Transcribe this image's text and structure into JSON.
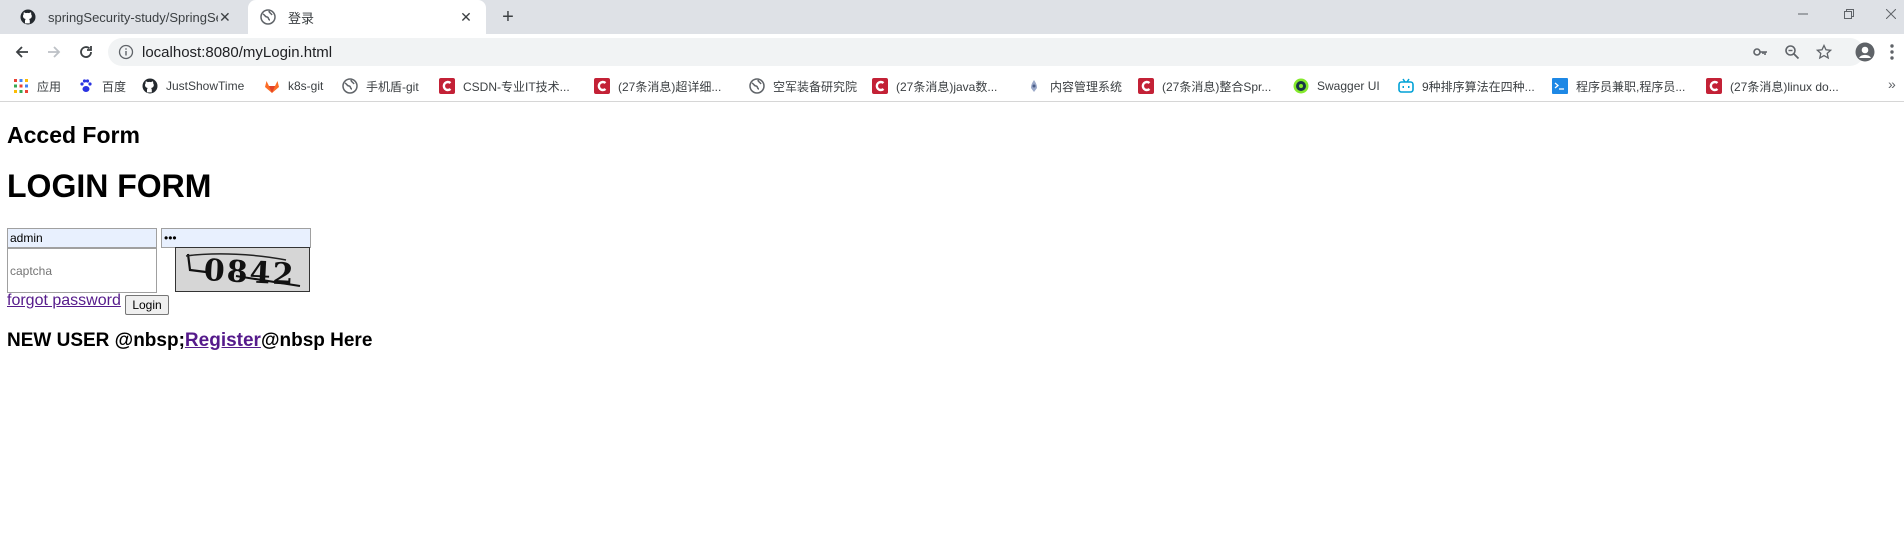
{
  "browser": {
    "tabs": [
      {
        "title": "springSecurity-study/SpringSecu",
        "icon": "github-icon",
        "active": false
      },
      {
        "title": "登录",
        "icon": "globe-icon",
        "active": true
      }
    ],
    "new_tab_symbol": "+",
    "tab_close_symbol": "✕",
    "address_url": "localhost:8080/myLogin.html",
    "bookmarks": [
      {
        "label": "应用",
        "icon": "apps-grid-icon"
      },
      {
        "label": "百度",
        "icon": "baidu-paw-icon"
      },
      {
        "label": "JustShowTime",
        "icon": "github-icon"
      },
      {
        "label": "k8s-git",
        "icon": "gitlab-icon"
      },
      {
        "label": "手机盾-git",
        "icon": "globe-icon"
      },
      {
        "label": "CSDN-专业IT技术...",
        "icon": "csdn-icon"
      },
      {
        "label": "(27条消息)超详细...",
        "icon": "csdn-icon"
      },
      {
        "label": "空军装备研究院",
        "icon": "globe-icon"
      },
      {
        "label": "(27条消息)java数...",
        "icon": "csdn-icon"
      },
      {
        "label": "内容管理系统",
        "icon": "cms-icon"
      },
      {
        "label": "(27条消息)整合Spr...",
        "icon": "csdn-icon"
      },
      {
        "label": "Swagger UI",
        "icon": "swagger-icon"
      },
      {
        "label": "9种排序算法在四种...",
        "icon": "bilibili-icon"
      },
      {
        "label": "程序员兼职,程序员...",
        "icon": "terminal-icon"
      },
      {
        "label": "(27条消息)linux do...",
        "icon": "csdn-icon"
      }
    ],
    "bookmarks_more": "»"
  },
  "page": {
    "heading_small": "Acced Form",
    "heading_big": "LOGIN FORM",
    "username_value": "admin",
    "password_value": "•••",
    "captcha_placeholder": "captcha",
    "captcha_text": "0842",
    "forgot_link": "forgot password",
    "login_button": "Login",
    "new_user_prefix": "NEW USER @nbsp;",
    "register_link": "Register",
    "new_user_suffix": "@nbsp Here"
  }
}
